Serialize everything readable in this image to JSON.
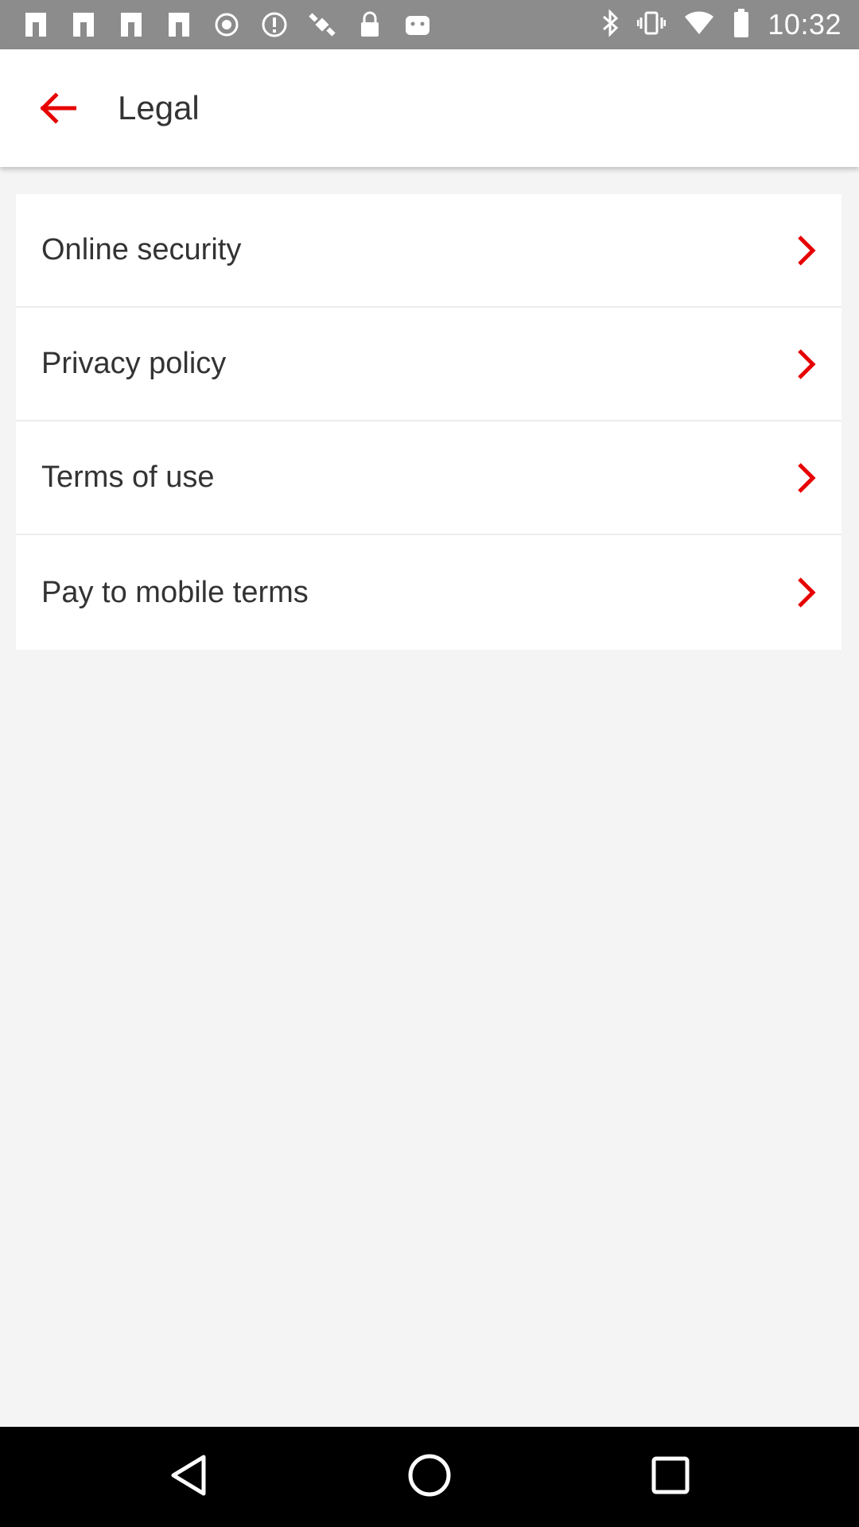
{
  "status_bar": {
    "time": "10:32",
    "left_icons": [
      "notification-icon",
      "notification-icon",
      "notification-icon",
      "notification-icon",
      "record-icon",
      "alert-icon",
      "satellite-icon",
      "lock-icon",
      "android-icon"
    ],
    "right_icons": [
      "bluetooth-icon",
      "vibrate-icon",
      "wifi-icon",
      "battery-icon"
    ]
  },
  "app_bar": {
    "title": "Legal",
    "back_icon": "back-arrow-icon"
  },
  "list": {
    "items": [
      {
        "label": "Online security"
      },
      {
        "label": "Privacy policy"
      },
      {
        "label": "Terms of use"
      },
      {
        "label": "Pay to mobile terms"
      }
    ]
  },
  "nav_bar": {
    "buttons": [
      "back-triangle-icon",
      "home-circle-icon",
      "recents-square-icon"
    ]
  },
  "colors": {
    "accent": "#e60000",
    "status_bar": "#8c8c8c",
    "background": "#f4f4f4",
    "text": "#333333"
  }
}
